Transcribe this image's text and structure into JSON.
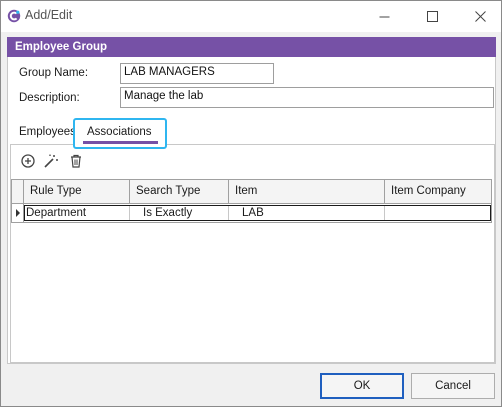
{
  "window": {
    "title": "Add/Edit"
  },
  "group_header": "Employee Group",
  "form": {
    "group_name_label": "Group Name:",
    "group_name_value": "LAB MANAGERS",
    "description_label": "Description:",
    "description_value": "Manage the lab"
  },
  "tabs": [
    {
      "label": "Employees",
      "active": false
    },
    {
      "label": "Associations",
      "active": true
    }
  ],
  "toolbar": {
    "icons": [
      "add-circle-icon",
      "magic-wand-icon",
      "trash-icon"
    ]
  },
  "grid": {
    "columns": [
      "Rule Type",
      "Search Type",
      "Item",
      "Item Company"
    ],
    "rows": [
      [
        "Department",
        "Is Exactly",
        "LAB",
        ""
      ]
    ]
  },
  "footer": {
    "ok_first": "O",
    "ok_rest": "K",
    "cancel_first": "C",
    "cancel_rest": "ancel"
  },
  "colors": {
    "header": "#7651a6",
    "focus_highlight": "#2fb6f0",
    "ok_border": "#1f5fbf"
  }
}
